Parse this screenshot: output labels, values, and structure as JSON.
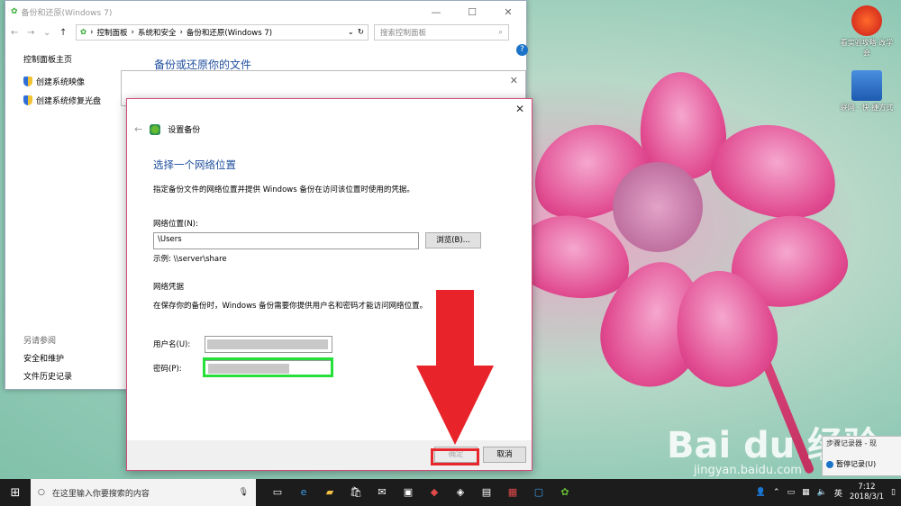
{
  "desktop": {
    "icons": [
      {
        "label": "看实验攻略 改学会"
      },
      {
        "label": "联网 - 快 捷方式"
      }
    ]
  },
  "bg_window": {
    "title": "备份和还原(Windows 7)",
    "breadcrumb": [
      "控制面板",
      "系统和安全",
      "备份和还原(Windows 7)"
    ],
    "search_placeholder": "搜索控制面板",
    "left_nav": {
      "home": "控制面板主页",
      "items": [
        "创建系统映像",
        "创建系统修复光盘"
      ]
    },
    "heading": "备份或还原你的文件",
    "see_also": {
      "title": "另请参阅",
      "items": [
        "安全和维护",
        "文件历史记录"
      ]
    }
  },
  "dialog": {
    "header": "设置备份",
    "title": "选择一个网络位置",
    "description": "指定备份文件的网络位置并提供 Windows 备份在访问该位置时使用的凭据。",
    "location_label": "网络位置(N):",
    "location_value": "\\Users",
    "browse_button": "浏览(B)...",
    "example": "示例: \\\\server\\share",
    "credentials_title": "网络凭据",
    "credentials_desc": "在保存你的备份时，Windows 备份需要你提供用户名和密码才能访问网络位置。",
    "username_label": "用户名(U):",
    "password_label": "密码(P):",
    "ok_button": "确定",
    "cancel_button": "取消"
  },
  "watermark": {
    "brand": "Bai du 经验",
    "url": "jingyan.baidu.com"
  },
  "recorder": {
    "title": "步骤记录器 - 现",
    "pause": "暂停记录(U)"
  },
  "taskbar": {
    "search_placeholder": "在这里输入你要搜索的内容",
    "ime": "英",
    "time": "7:12",
    "date": "2018/3/1"
  },
  "colors": {
    "accent_blue": "#1e4e9e",
    "annotation_green": "#26e03a",
    "annotation_red": "#e8272c"
  }
}
